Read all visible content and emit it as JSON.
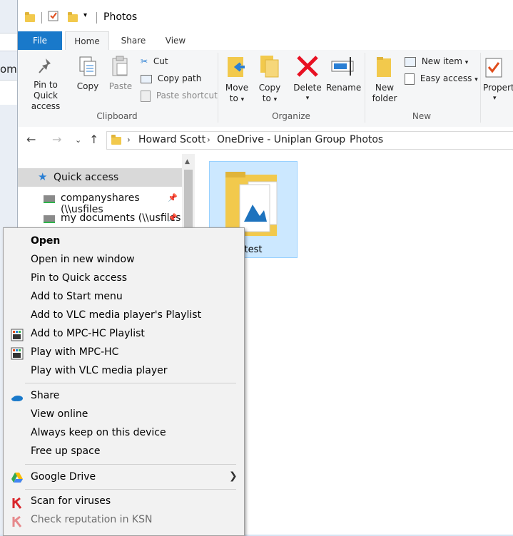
{
  "window": {
    "title": "Photos"
  },
  "background": {
    "fragment_text": "om"
  },
  "tabs": {
    "file": "File",
    "home": "Home",
    "share": "Share",
    "view": "View"
  },
  "ribbon": {
    "clipboard": {
      "label": "Clipboard",
      "pin_line1": "Pin to Quick",
      "pin_line2": "access",
      "copy": "Copy",
      "paste": "Paste",
      "cut": "Cut",
      "copy_path": "Copy path",
      "paste_shortcut": "Paste shortcut"
    },
    "organize": {
      "label": "Organize",
      "move_line1": "Move",
      "move_line2": "to",
      "copy_line1": "Copy",
      "copy_line2": "to",
      "delete": "Delete",
      "rename": "Rename"
    },
    "new": {
      "label": "New",
      "folder_line1": "New",
      "folder_line2": "folder",
      "new_item": "New item",
      "easy_access": "Easy access"
    },
    "open": {
      "properties": "Propert"
    }
  },
  "address": {
    "crumbs": [
      "Howard Scott",
      "OneDrive - Uniplan Group",
      "Photos"
    ]
  },
  "navpane": {
    "quick_access": "Quick access",
    "items": [
      "companyshares (\\\\usfiles",
      "my documents (\\\\usfiles"
    ]
  },
  "content": {
    "file_name": "test"
  },
  "context_menu": {
    "group1": [
      "Open",
      "Open in new window",
      "Pin to Quick access",
      "Add to Start menu",
      "Add to VLC media player's Playlist",
      "Add to MPC-HC Playlist",
      "Play with MPC-HC",
      "Play with VLC media player"
    ],
    "group2": [
      "Share",
      "View online",
      "Always keep on this device",
      "Free up space"
    ],
    "group3": [
      "Google Drive"
    ],
    "group4": [
      "Scan for viruses",
      "Check reputation in KSN"
    ]
  },
  "colors": {
    "accent": "#1979ca",
    "selection": "#cce8ff",
    "folder": "#f2c94c",
    "delete_red": "#e81123"
  }
}
